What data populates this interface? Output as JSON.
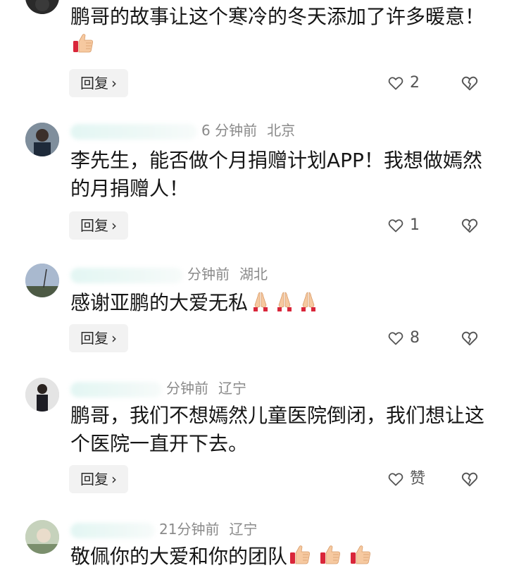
{
  "comments": [
    {
      "meta_time": "",
      "meta_loc": "",
      "text": "鹏哥的故事让这个寒冷的冬天添加了许多暖意！",
      "emojis": [
        "thumbs-up"
      ],
      "reply_label": "回复",
      "like_count": "2"
    },
    {
      "meta_time": "6 分钟前",
      "meta_loc": "北京",
      "text": "李先生，能否做个月捐赠计划APP！我想做嫣然的月捐赠人！",
      "emojis": [],
      "reply_label": "回复",
      "like_count": "1"
    },
    {
      "meta_time": "分钟前",
      "meta_loc": "湖北",
      "text": "感谢亚鹏的大爱无私",
      "emojis": [
        "folded-hands",
        "folded-hands",
        "folded-hands"
      ],
      "reply_label": "回复",
      "like_count": "8"
    },
    {
      "meta_time": "分钟前",
      "meta_loc": "辽宁",
      "text": "鹏哥，我们不想嫣然儿童医院倒闭，我们想让这个医院一直开下去。",
      "emojis": [],
      "reply_label": "回复",
      "like_count": "赞"
    },
    {
      "meta_time": "21分钟前",
      "meta_loc": "辽宁",
      "text": "敬佩你的大爱和你的团队",
      "emojis": [
        "thumbs-up",
        "thumbs-up",
        "thumbs-up"
      ],
      "reply_label": "",
      "like_count": ""
    }
  ]
}
